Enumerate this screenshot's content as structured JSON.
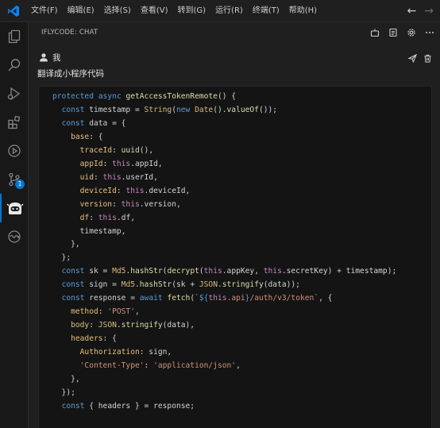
{
  "menu": [
    "文件(F)",
    "编辑(E)",
    "选择(S)",
    "查看(V)",
    "转到(G)",
    "运行(R)",
    "终端(T)",
    "帮助(H)"
  ],
  "panel": {
    "title": "IFLYCODE: CHAT"
  },
  "message": {
    "user": "我",
    "text": "翻译成小程序代码"
  },
  "activity_badge": "1",
  "code_lines": [
    "protected async getAccessTokenRemote() {",
    "  const timestamp = String(new Date().valueOf());",
    "  const data = {",
    "    base: {",
    "      traceId: uuid(),",
    "      appId: this.appId,",
    "      uid: this.userId,",
    "      deviceId: this.deviceId,",
    "      version: this.version,",
    "      df: this.df,",
    "      timestamp,",
    "    },",
    "  };",
    "  const sk = Md5.hashStr(decrypt(this.appKey, this.secretKey) + timestamp);",
    "  const sign = Md5.hashStr(sk + JSON.stringify(data));",
    "  const response = await fetch(`${this.api}/auth/v3/token`, {",
    "    method: 'POST',",
    "    body: JSON.stringify(data),",
    "    headers: {",
    "      Authorization: sign,",
    "      'Content-Type': 'application/json',",
    "    },",
    "  });",
    "  const { headers } = response;"
  ]
}
